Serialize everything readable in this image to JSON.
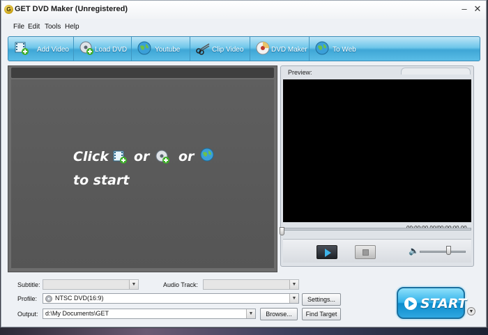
{
  "window": {
    "title": "GET DVD Maker (Unregistered)",
    "logo_letter": "G"
  },
  "menu": {
    "items": [
      "File",
      "Edit",
      "Tools",
      "Help"
    ]
  },
  "toolbar": {
    "buttons": [
      {
        "label": "Add Video",
        "icon": "film-plus-icon"
      },
      {
        "label": "Load DVD",
        "icon": "dvd-disc-plus-icon"
      },
      {
        "label": "Youtube",
        "icon": "globe-icon"
      },
      {
        "label": "Clip Video",
        "icon": "scissors-icon"
      },
      {
        "label": "DVD Maker",
        "icon": "dvd-disc-icon"
      },
      {
        "label": "To Web",
        "icon": "globe-upload-icon"
      }
    ]
  },
  "drop_hint": {
    "click": "Click",
    "or1": "or",
    "or2": "or",
    "to_start": "to start"
  },
  "preview": {
    "label": "Preview:",
    "time": "00:00:00.00/00:00:00.00",
    "seek_position": 0,
    "volume": 0.6
  },
  "bottom": {
    "subtitle_label": "Subtitle:",
    "subtitle_value": "",
    "audio_label": "Audio Track:",
    "audio_value": "",
    "profile_label": "Profile:",
    "profile_value": "NTSC DVD(16:9)",
    "output_label": "Output:",
    "output_value": "d:\\My Documents\\GET",
    "settings_label": "Settings...",
    "browse_label": "Browse...",
    "find_target_label": "Find Target"
  },
  "start": {
    "label": "START"
  },
  "colors": {
    "accent": "#32b2ea",
    "toolbar": "#5bbde6",
    "workspace": "#5f5f5f"
  }
}
